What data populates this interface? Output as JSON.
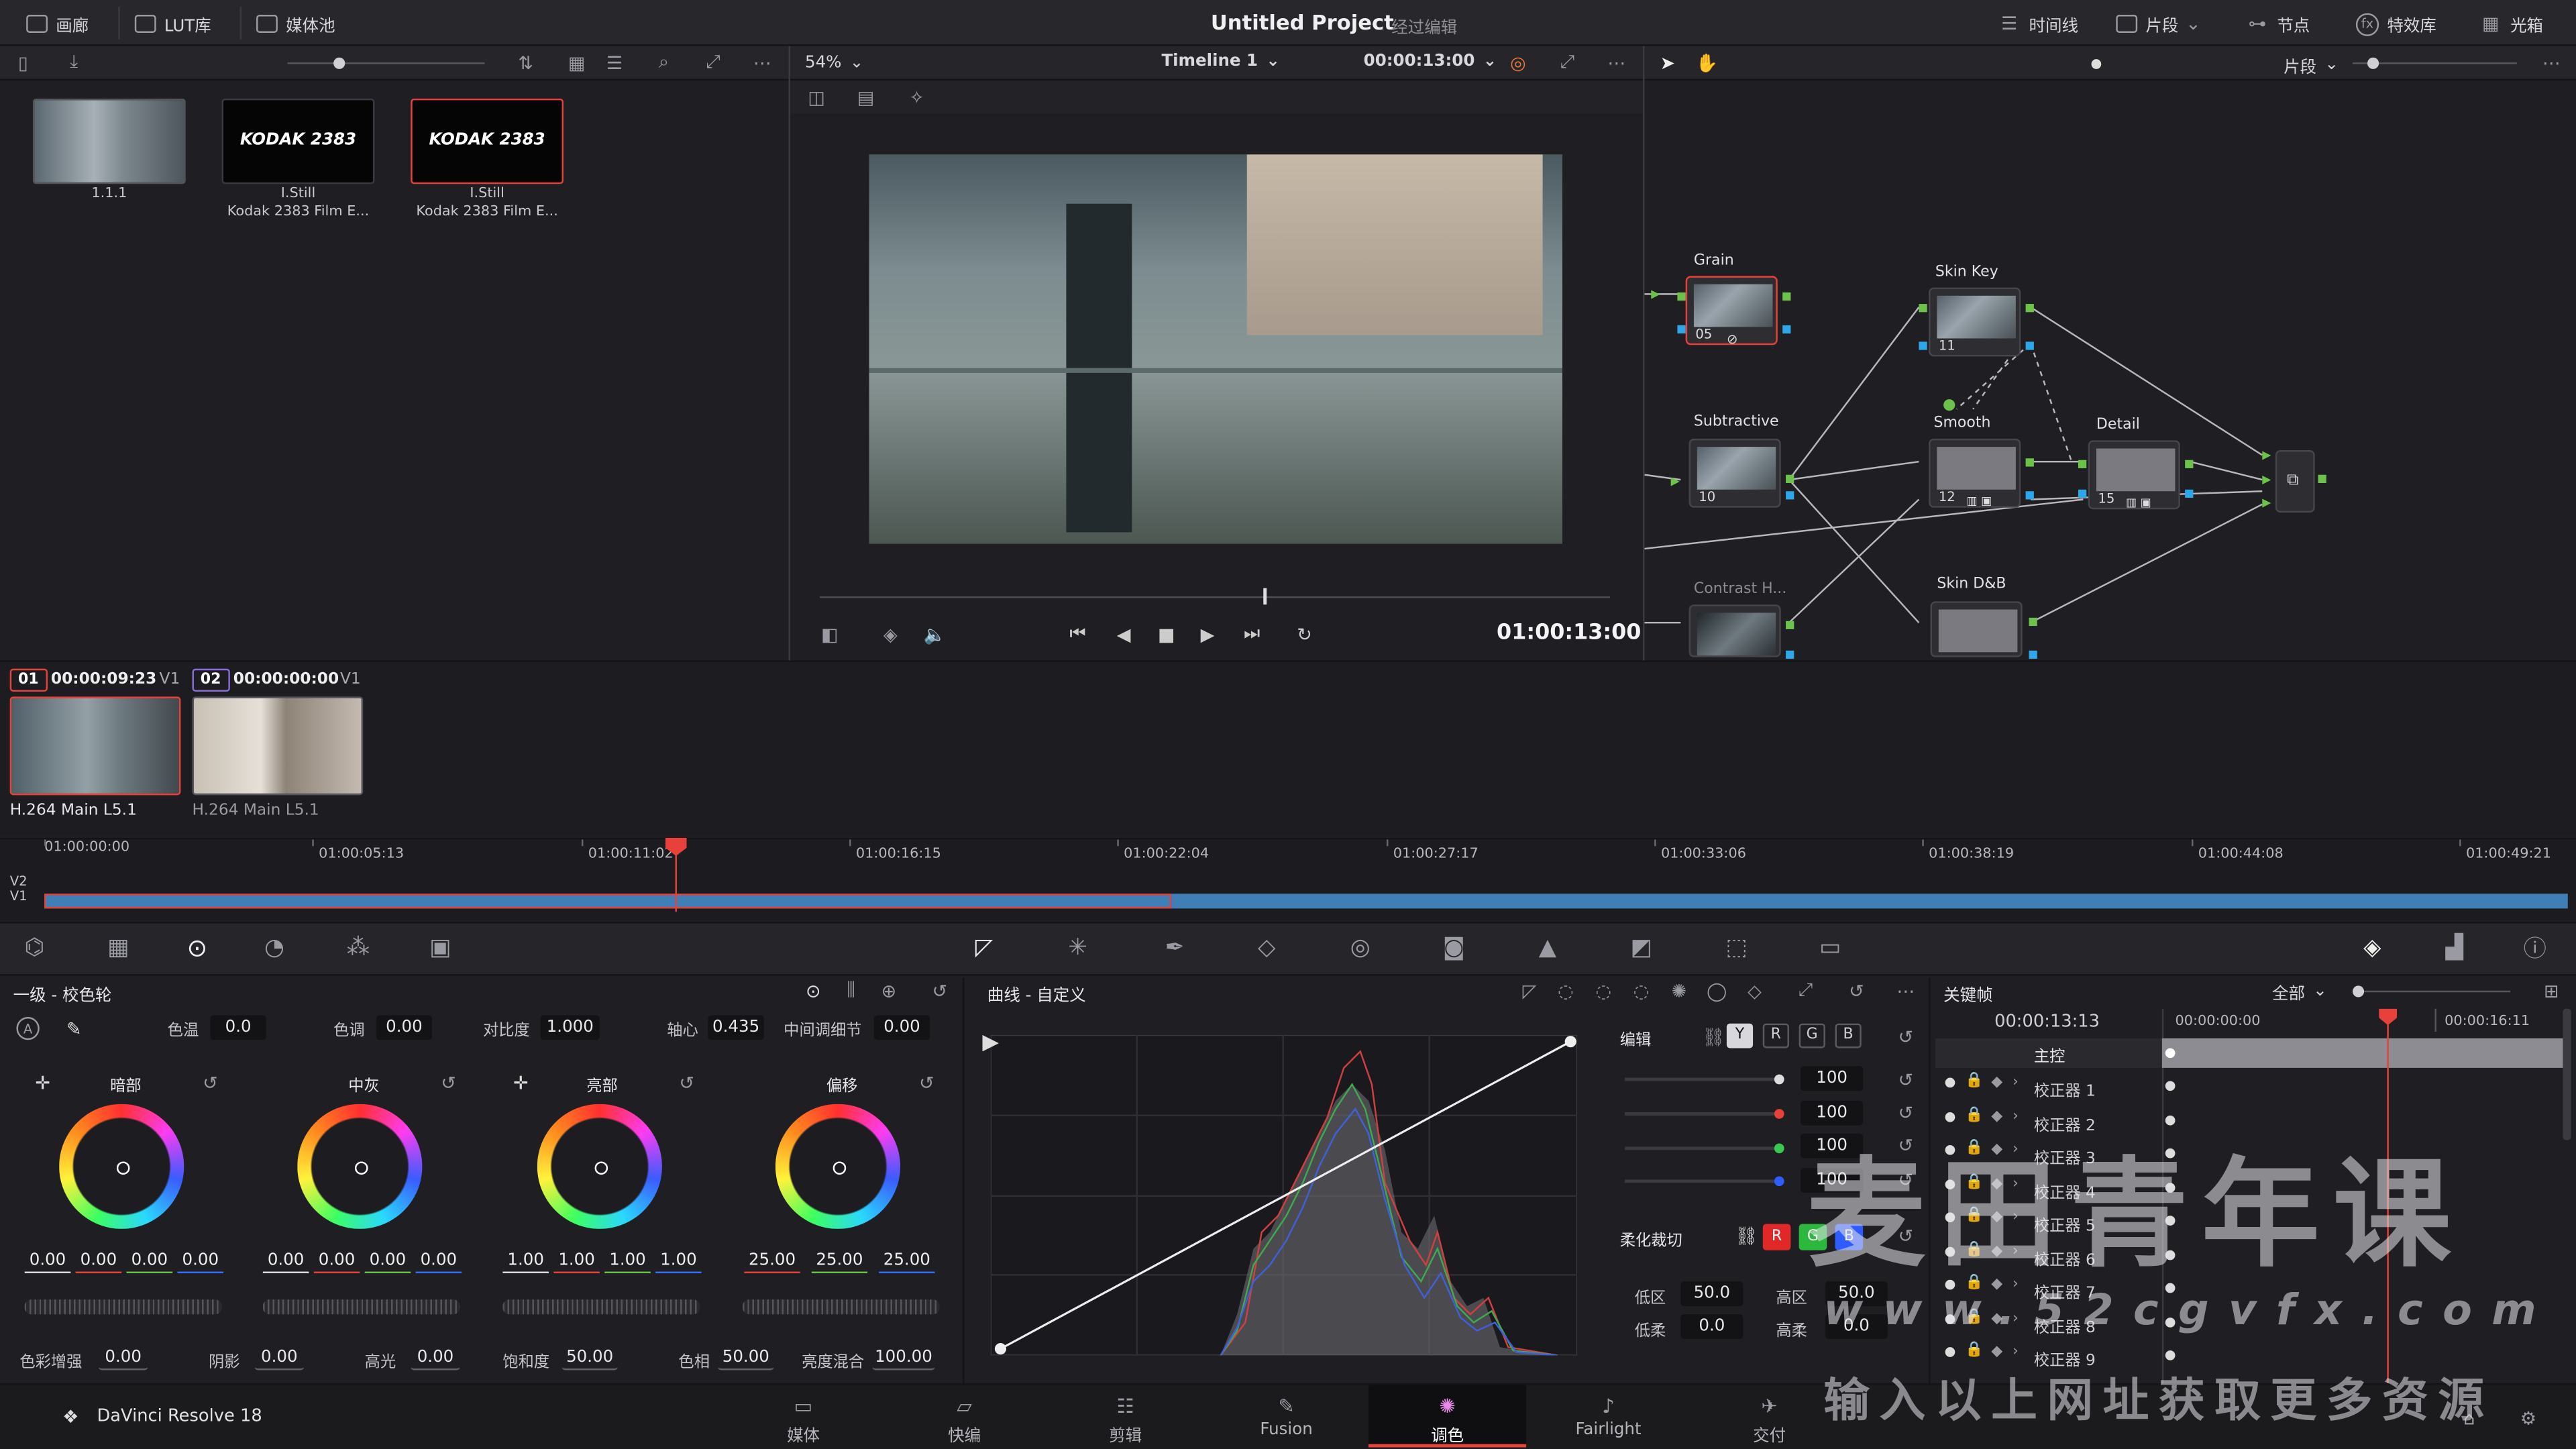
{
  "app": {
    "name": "DaVinci Resolve 18"
  },
  "topbar": {
    "left_tabs": [
      {
        "label": "画廊",
        "icon": "gallery-icon"
      },
      {
        "label": "LUT库",
        "icon": "lut-icon"
      },
      {
        "label": "媒体池",
        "icon": "media-pool-icon"
      }
    ],
    "project_title": "Untitled Project",
    "project_status": "经过编辑",
    "right_tabs": [
      {
        "label": "时间线",
        "icon": "timeline-icon"
      },
      {
        "label": "片段",
        "icon": "clips-icon"
      },
      {
        "label": "节点",
        "icon": "nodes-icon"
      },
      {
        "label": "特效库",
        "icon": "effects-icon"
      },
      {
        "label": "光箱",
        "icon": "lightbox-icon"
      }
    ]
  },
  "viewer": {
    "zoom": "54%",
    "timeline_name": "Timeline 1",
    "source_timecode": "00:00:13:00",
    "playhead_timecode": "01:00:13:00"
  },
  "nodes_toolbar": {
    "mode": "片段"
  },
  "gallery": {
    "stills": [
      {
        "line1": "1.1.1",
        "line2": "",
        "logo": ""
      },
      {
        "line1": "I.Still",
        "line2": "Kodak 2383 Film E...",
        "logo": "KODAK 2383"
      },
      {
        "line1": "I.Still",
        "line2": "Kodak 2383 Film E...",
        "logo": "KODAK 2383"
      }
    ]
  },
  "nodes": [
    {
      "label": "Grain",
      "num": "05"
    },
    {
      "label": "Subtractive",
      "num": "10"
    },
    {
      "label": "Contrast H...",
      "num": ""
    },
    {
      "label": "Skin Key",
      "num": "11"
    },
    {
      "label": "Smooth",
      "num": "12"
    },
    {
      "label": "Detail",
      "num": "15"
    },
    {
      "label": "Skin D&B",
      "num": ""
    }
  ],
  "clips": [
    {
      "index": "01",
      "timecode": "00:00:09:23",
      "track": "V1",
      "codec": "H.264 Main L5.1"
    },
    {
      "index": "02",
      "timecode": "00:00:00:00",
      "track": "V1",
      "codec": "H.264 Main L5.1"
    }
  ],
  "timeline": {
    "tracks": [
      "V2",
      "V1"
    ],
    "ticks": [
      "01:00:00:00",
      "01:00:05:13",
      "01:00:11:02",
      "01:00:16:15",
      "01:00:22:04",
      "01:00:27:17",
      "01:00:33:06",
      "01:00:38:19",
      "01:00:44:08",
      "01:00:49:21"
    ]
  },
  "primaries": {
    "title": "一级 - 校色轮",
    "row1": [
      {
        "label": "色温",
        "value": "0.0"
      },
      {
        "label": "色调",
        "value": "0.00"
      },
      {
        "label": "对比度",
        "value": "1.000"
      },
      {
        "label": "轴心",
        "value": "0.435"
      },
      {
        "label": "中间调细节",
        "value": "0.00"
      }
    ],
    "wheels": [
      {
        "label": "暗部",
        "values": [
          "0.00",
          "0.00",
          "0.00",
          "0.00"
        ]
      },
      {
        "label": "中灰",
        "values": [
          "0.00",
          "0.00",
          "0.00",
          "0.00"
        ]
      },
      {
        "label": "亮部",
        "values": [
          "1.00",
          "1.00",
          "1.00",
          "1.00"
        ]
      },
      {
        "label": "偏移",
        "values": [
          "25.00",
          "25.00",
          "25.00"
        ]
      }
    ],
    "row2": [
      {
        "label": "色彩增强",
        "value": "0.00"
      },
      {
        "label": "阴影",
        "value": "0.00"
      },
      {
        "label": "高光",
        "value": "0.00"
      },
      {
        "label": "饱和度",
        "value": "50.00"
      },
      {
        "label": "色相",
        "value": "50.00"
      },
      {
        "label": "亮度混合",
        "value": "100.00"
      }
    ]
  },
  "curves": {
    "title": "曲线 - 自定义",
    "edit_label": "编辑",
    "channels": [
      "Y",
      "R",
      "G",
      "B"
    ],
    "intensity": [
      "100",
      "100",
      "100",
      "100"
    ],
    "soft_clip_label": "柔化裁切",
    "soft_channels": [
      "R",
      "G",
      "B"
    ],
    "low_label": "低区",
    "low_value": "50.0",
    "high_label": "高区",
    "high_value": "50.0",
    "low_soft_label": "低柔",
    "low_soft_value": "0.0",
    "high_soft_label": "高柔",
    "high_soft_value": "0.0"
  },
  "keyframes": {
    "title": "关键帧",
    "filter": "全部",
    "current_timecode": "00:00:13:13",
    "ruler_start": "00:00:00:00",
    "ruler_end": "00:00:16:11",
    "master": "主控",
    "correctors": [
      "校正器 1",
      "校正器 2",
      "校正器 3",
      "校正器 4",
      "校正器 5",
      "校正器 6",
      "校正器 7",
      "校正器 8",
      "校正器 9"
    ]
  },
  "pages": [
    {
      "label": "媒体",
      "icon": "media-page-icon"
    },
    {
      "label": "快编",
      "icon": "cut-page-icon"
    },
    {
      "label": "剪辑",
      "icon": "edit-page-icon"
    },
    {
      "label": "Fusion",
      "icon": "fusion-page-icon"
    },
    {
      "label": "调色",
      "icon": "color-page-icon"
    },
    {
      "label": "Fairlight",
      "icon": "fairlight-page-icon"
    },
    {
      "label": "交付",
      "icon": "deliver-page-icon"
    }
  ],
  "active_page": "调色",
  "watermark": {
    "line1": "麦田青年课",
    "line2": "www.52cgvfx.com",
    "line3": "输入以上网址获取更多资源"
  },
  "colors": {
    "accent_red": "#e8403a",
    "timeline_blue": "#3f7fb5",
    "pin_green": "#6cc24a",
    "pin_blue": "#2fa6e8"
  }
}
